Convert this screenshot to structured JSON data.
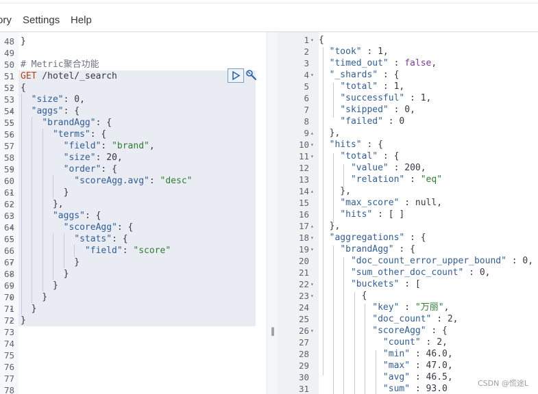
{
  "menu": {
    "history_label": "ory",
    "settings_label": "Settings",
    "help_label": "Help"
  },
  "watermark": "CSDN @慌途L",
  "request_lines": [
    {
      "num": "48",
      "parts": [
        [
          "n",
          "}"
        ]
      ]
    },
    {
      "num": "49",
      "parts": []
    },
    {
      "num": "50",
      "parts": [
        [
          "cm",
          "# Metric聚合功能"
        ]
      ]
    },
    {
      "num": "51",
      "parts": [
        [
          "kw",
          "GET"
        ],
        [
          "n",
          " /hotel/_search"
        ]
      ]
    },
    {
      "num": "52",
      "fold": "▾",
      "parts": [
        [
          "n",
          "{"
        ]
      ]
    },
    {
      "num": "53",
      "parts": [
        [
          "n",
          "  "
        ],
        [
          "k",
          "\"size\""
        ],
        [
          "n",
          ": 0,"
        ]
      ]
    },
    {
      "num": "54",
      "fold": "▾",
      "parts": [
        [
          "n",
          "  "
        ],
        [
          "k",
          "\"aggs\""
        ],
        [
          "n",
          ": {"
        ]
      ]
    },
    {
      "num": "55",
      "fold": "▾",
      "parts": [
        [
          "n",
          "    "
        ],
        [
          "k",
          "\"brandAgg\""
        ],
        [
          "n",
          ": {"
        ]
      ]
    },
    {
      "num": "56",
      "fold": "▾",
      "parts": [
        [
          "n",
          "      "
        ],
        [
          "k",
          "\"terms\""
        ],
        [
          "n",
          ": {"
        ]
      ]
    },
    {
      "num": "57",
      "parts": [
        [
          "n",
          "        "
        ],
        [
          "k",
          "\"field\""
        ],
        [
          "n",
          ": "
        ],
        [
          "s",
          "\"brand\""
        ],
        [
          "n",
          ","
        ]
      ]
    },
    {
      "num": "58",
      "parts": [
        [
          "n",
          "        "
        ],
        [
          "k",
          "\"size\""
        ],
        [
          "n",
          ": 20,"
        ]
      ]
    },
    {
      "num": "59",
      "fold": "▾",
      "parts": [
        [
          "n",
          "        "
        ],
        [
          "k",
          "\"order\""
        ],
        [
          "n",
          ": {"
        ]
      ]
    },
    {
      "num": "60",
      "parts": [
        [
          "n",
          "          "
        ],
        [
          "k",
          "\"scoreAgg.avg\""
        ],
        [
          "n",
          ": "
        ],
        [
          "s",
          "\"desc\""
        ]
      ]
    },
    {
      "num": "61",
      "fold": "▴",
      "parts": [
        [
          "n",
          "        }"
        ]
      ]
    },
    {
      "num": "62",
      "fold": "▴",
      "parts": [
        [
          "n",
          "      },"
        ]
      ]
    },
    {
      "num": "63",
      "fold": "▾",
      "parts": [
        [
          "n",
          "      "
        ],
        [
          "k",
          "\"aggs\""
        ],
        [
          "n",
          ": {"
        ]
      ]
    },
    {
      "num": "64",
      "fold": "▾",
      "parts": [
        [
          "n",
          "        "
        ],
        [
          "k",
          "\"scoreAgg\""
        ],
        [
          "n",
          ": {"
        ]
      ]
    },
    {
      "num": "65",
      "fold": "▾",
      "parts": [
        [
          "n",
          "          "
        ],
        [
          "k",
          "\"stats\""
        ],
        [
          "n",
          ": {"
        ]
      ]
    },
    {
      "num": "66",
      "parts": [
        [
          "n",
          "            "
        ],
        [
          "k",
          "\"field\""
        ],
        [
          "n",
          ": "
        ],
        [
          "s",
          "\"score\""
        ]
      ]
    },
    {
      "num": "67",
      "fold": "▴",
      "parts": [
        [
          "n",
          "          }"
        ]
      ]
    },
    {
      "num": "68",
      "fold": "▴",
      "parts": [
        [
          "n",
          "        }"
        ]
      ]
    },
    {
      "num": "69",
      "fold": "▴",
      "parts": [
        [
          "n",
          "      }"
        ]
      ]
    },
    {
      "num": "70",
      "fold": "▴",
      "parts": [
        [
          "n",
          "    }"
        ]
      ]
    },
    {
      "num": "71",
      "fold": "▴",
      "parts": [
        [
          "n",
          "  }"
        ]
      ]
    },
    {
      "num": "72",
      "fold": "▴",
      "parts": [
        [
          "n",
          "}"
        ]
      ]
    },
    {
      "num": "73",
      "parts": []
    },
    {
      "num": "74",
      "parts": []
    },
    {
      "num": "75",
      "parts": []
    },
    {
      "num": "76",
      "parts": []
    },
    {
      "num": "77",
      "parts": []
    },
    {
      "num": "78",
      "parts": []
    }
  ],
  "response_lines": [
    {
      "num": "1",
      "fold": "▾",
      "parts": [
        [
          "n",
          "{"
        ]
      ]
    },
    {
      "num": "2",
      "parts": [
        [
          "n",
          "  "
        ],
        [
          "k",
          "\"took\""
        ],
        [
          "n",
          " : 1,"
        ]
      ]
    },
    {
      "num": "3",
      "parts": [
        [
          "n",
          "  "
        ],
        [
          "k",
          "\"timed_out\""
        ],
        [
          "n",
          " : "
        ],
        [
          "bool",
          "false"
        ],
        [
          "n",
          ","
        ]
      ]
    },
    {
      "num": "4",
      "fold": "▾",
      "parts": [
        [
          "n",
          "  "
        ],
        [
          "k",
          "\"_shards\""
        ],
        [
          "n",
          " : {"
        ]
      ]
    },
    {
      "num": "5",
      "parts": [
        [
          "n",
          "    "
        ],
        [
          "k",
          "\"total\""
        ],
        [
          "n",
          " : 1,"
        ]
      ]
    },
    {
      "num": "6",
      "parts": [
        [
          "n",
          "    "
        ],
        [
          "k",
          "\"successful\""
        ],
        [
          "n",
          " : 1,"
        ]
      ]
    },
    {
      "num": "7",
      "parts": [
        [
          "n",
          "    "
        ],
        [
          "k",
          "\"skipped\""
        ],
        [
          "n",
          " : 0,"
        ]
      ]
    },
    {
      "num": "8",
      "parts": [
        [
          "n",
          "    "
        ],
        [
          "k",
          "\"failed\""
        ],
        [
          "n",
          " : 0"
        ]
      ]
    },
    {
      "num": "9",
      "fold": "▴",
      "parts": [
        [
          "n",
          "  },"
        ]
      ]
    },
    {
      "num": "10",
      "fold": "▾",
      "parts": [
        [
          "n",
          "  "
        ],
        [
          "k",
          "\"hits\""
        ],
        [
          "n",
          " : {"
        ]
      ]
    },
    {
      "num": "11",
      "fold": "▾",
      "parts": [
        [
          "n",
          "    "
        ],
        [
          "k",
          "\"total\""
        ],
        [
          "n",
          " : {"
        ]
      ]
    },
    {
      "num": "12",
      "parts": [
        [
          "n",
          "      "
        ],
        [
          "k",
          "\"value\""
        ],
        [
          "n",
          " : 200,"
        ]
      ]
    },
    {
      "num": "13",
      "parts": [
        [
          "n",
          "      "
        ],
        [
          "k",
          "\"relation\""
        ],
        [
          "n",
          " : "
        ],
        [
          "s",
          "\"eq\""
        ]
      ]
    },
    {
      "num": "14",
      "fold": "▴",
      "parts": [
        [
          "n",
          "    },"
        ]
      ]
    },
    {
      "num": "15",
      "parts": [
        [
          "n",
          "    "
        ],
        [
          "k",
          "\"max_score\""
        ],
        [
          "n",
          " : null,"
        ]
      ]
    },
    {
      "num": "16",
      "parts": [
        [
          "n",
          "    "
        ],
        [
          "k",
          "\"hits\""
        ],
        [
          "n",
          " : [ ]"
        ]
      ]
    },
    {
      "num": "17",
      "fold": "▴",
      "parts": [
        [
          "n",
          "  },"
        ]
      ]
    },
    {
      "num": "18",
      "fold": "▾",
      "parts": [
        [
          "n",
          "  "
        ],
        [
          "k",
          "\"aggregations\""
        ],
        [
          "n",
          " : {"
        ]
      ]
    },
    {
      "num": "19",
      "fold": "▾",
      "parts": [
        [
          "n",
          "    "
        ],
        [
          "k",
          "\"brandAgg\""
        ],
        [
          "n",
          " : {"
        ]
      ]
    },
    {
      "num": "20",
      "parts": [
        [
          "n",
          "      "
        ],
        [
          "k",
          "\"doc_count_error_upper_bound\""
        ],
        [
          "n",
          " : 0,"
        ]
      ]
    },
    {
      "num": "21",
      "parts": [
        [
          "n",
          "      "
        ],
        [
          "k",
          "\"sum_other_doc_count\""
        ],
        [
          "n",
          " : 0,"
        ]
      ]
    },
    {
      "num": "22",
      "fold": "▾",
      "parts": [
        [
          "n",
          "      "
        ],
        [
          "k",
          "\"buckets\""
        ],
        [
          "n",
          " : ["
        ]
      ]
    },
    {
      "num": "23",
      "fold": "▾",
      "parts": [
        [
          "n",
          "        {"
        ]
      ]
    },
    {
      "num": "24",
      "parts": [
        [
          "n",
          "          "
        ],
        [
          "k",
          "\"key\""
        ],
        [
          "n",
          " : "
        ],
        [
          "s",
          "\"万丽\""
        ],
        [
          "n",
          ","
        ]
      ]
    },
    {
      "num": "25",
      "parts": [
        [
          "n",
          "          "
        ],
        [
          "k",
          "\"doc_count\""
        ],
        [
          "n",
          " : 2,"
        ]
      ]
    },
    {
      "num": "26",
      "fold": "▾",
      "parts": [
        [
          "n",
          "          "
        ],
        [
          "k",
          "\"scoreAgg\""
        ],
        [
          "n",
          " : {"
        ]
      ]
    },
    {
      "num": "27",
      "parts": [
        [
          "n",
          "            "
        ],
        [
          "k",
          "\"count\""
        ],
        [
          "n",
          " : 2,"
        ]
      ]
    },
    {
      "num": "28",
      "parts": [
        [
          "n",
          "            "
        ],
        [
          "k",
          "\"min\""
        ],
        [
          "n",
          " : 46.0,"
        ]
      ]
    },
    {
      "num": "29",
      "parts": [
        [
          "n",
          "            "
        ],
        [
          "k",
          "\"max\""
        ],
        [
          "n",
          " : 47.0,"
        ]
      ]
    },
    {
      "num": "30",
      "parts": [
        [
          "n",
          "            "
        ],
        [
          "k",
          "\"avg\""
        ],
        [
          "n",
          " : 46.5,"
        ]
      ]
    },
    {
      "num": "31",
      "parts": [
        [
          "n",
          "            "
        ],
        [
          "k",
          "\"sum\""
        ],
        [
          "n",
          " : 93.0"
        ]
      ]
    }
  ]
}
